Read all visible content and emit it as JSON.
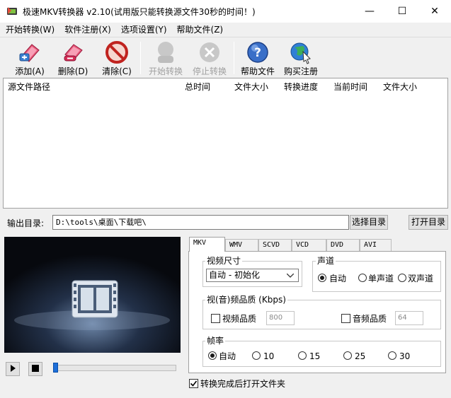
{
  "window": {
    "title": "极速MKV转换器 v2.10(试用版只能转换源文件30秒的时间！)",
    "minimize_glyph": "—",
    "maximize_glyph": "☐",
    "close_glyph": "✕"
  },
  "menu": [
    {
      "label": "开始转换(W)"
    },
    {
      "label": "软件注册(X)"
    },
    {
      "label": "选项设置(Y)"
    },
    {
      "label": "帮助文件(Z)"
    }
  ],
  "toolbar": {
    "add": {
      "label": "添加(A)",
      "icon": "add-film-icon",
      "color": "#d62b55"
    },
    "delete": {
      "label": "删除(D)",
      "icon": "delete-film-icon",
      "color": "#d62b55"
    },
    "clear": {
      "label": "清除(C)",
      "icon": "clear-icon",
      "color": "#e2322d"
    },
    "start": {
      "label": "开始转换",
      "icon": "start-icon",
      "disabled": true
    },
    "stop": {
      "label": "停止转换",
      "icon": "stop-icon",
      "disabled": true
    },
    "help": {
      "label": "帮助文件",
      "icon": "help-icon",
      "color": "#2a5fb8"
    },
    "buy": {
      "label": "购买注册",
      "icon": "buy-globe-icon",
      "color": "#1d8a4a"
    }
  },
  "file_list": {
    "columns": [
      {
        "label": "源文件路径"
      },
      {
        "label": "总时间"
      },
      {
        "label": "文件大小"
      },
      {
        "label": "转换进度"
      },
      {
        "label": "当前时间"
      },
      {
        "label": "文件大小"
      }
    ],
    "rows": []
  },
  "output": {
    "label": "输出目录:",
    "path": "D:\\tools\\桌面\\下载吧\\",
    "choose_button": "选择目录",
    "open_button": "打开目录"
  },
  "player": {
    "play_icon": "play-icon",
    "stop_icon": "stop-icon",
    "progress": 0.0
  },
  "tabs": [
    {
      "label": "MKV",
      "active": true
    },
    {
      "label": "WMV",
      "active": false
    },
    {
      "label": "SCVD",
      "active": false
    },
    {
      "label": "VCD",
      "active": false
    },
    {
      "label": "DVD",
      "active": false
    },
    {
      "label": "AVI",
      "active": false
    }
  ],
  "settings": {
    "video_size": {
      "title": "视频尺寸",
      "selected": "自动 - 初始化"
    },
    "channel": {
      "title": "声道",
      "options": [
        {
          "label": "自动",
          "selected": true
        },
        {
          "label": "单声道",
          "selected": false
        },
        {
          "label": "双声道",
          "selected": false
        }
      ]
    },
    "quality": {
      "title": "视(音)频品质 (Kbps)",
      "video_label": "视频品质",
      "video_value": "800",
      "video_checked": false,
      "audio_label": "音频品质",
      "audio_value": "64",
      "audio_checked": false
    },
    "fps": {
      "title": "帧率",
      "options": [
        {
          "label": "自动",
          "selected": true
        },
        {
          "label": "10",
          "selected": false
        },
        {
          "label": "15",
          "selected": false
        },
        {
          "label": "25",
          "selected": false
        },
        {
          "label": "30",
          "selected": false
        }
      ]
    },
    "open_after": {
      "label": "转换完成后打开文件夹",
      "checked": true
    }
  }
}
